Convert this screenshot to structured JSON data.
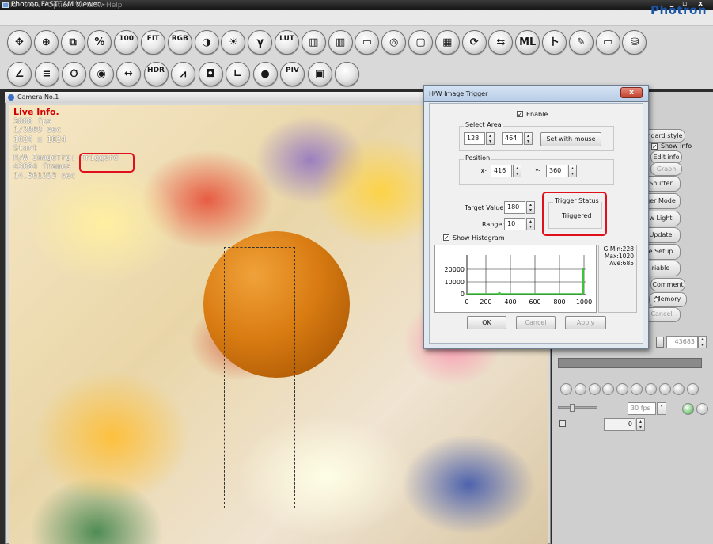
{
  "window": {
    "title": "Photron FASTCAM Viewer -",
    "min": "_",
    "max": "▫",
    "close": "x"
  },
  "menu": {
    "items": [
      "File",
      "View",
      "Option",
      "Window",
      "Help"
    ]
  },
  "brand": "Photron",
  "toolbar1": [
    {
      "name": "move",
      "glyph": "✥"
    },
    {
      "name": "zoom",
      "glyph": "⊕"
    },
    {
      "name": "clip",
      "glyph": "⧉"
    },
    {
      "name": "percent",
      "glyph": "%"
    },
    {
      "name": "zoom-100",
      "glyph": "100"
    },
    {
      "name": "fit",
      "glyph": "FIT"
    },
    {
      "name": "rgb",
      "glyph": "RGB"
    },
    {
      "name": "contrast",
      "glyph": "◑"
    },
    {
      "name": "brightness",
      "glyph": "☀"
    },
    {
      "name": "gamma",
      "glyph": "γ"
    },
    {
      "name": "lut-reset",
      "glyph": "LUT"
    },
    {
      "name": "color-bars",
      "glyph": "▥"
    },
    {
      "name": "reset-bars",
      "glyph": "▥"
    },
    {
      "name": "shading",
      "glyph": "▭"
    },
    {
      "name": "origin",
      "glyph": "◎"
    },
    {
      "name": "frame",
      "glyph": "▢"
    },
    {
      "name": "multi-window",
      "glyph": "▦"
    },
    {
      "name": "refresh",
      "glyph": "⟳"
    },
    {
      "name": "sync",
      "glyph": "⇆"
    },
    {
      "name": "multi-lock",
      "glyph": "ML"
    },
    {
      "name": "trigger",
      "glyph": "ト"
    },
    {
      "name": "pen",
      "glyph": "✎"
    },
    {
      "name": "display",
      "glyph": "▭"
    },
    {
      "name": "drive",
      "glyph": "⛁"
    }
  ],
  "toolbar2": [
    {
      "name": "angle",
      "glyph": "∠"
    },
    {
      "name": "level",
      "glyph": "≡"
    },
    {
      "name": "timer",
      "glyph": "⏱"
    },
    {
      "name": "record",
      "glyph": "◉"
    },
    {
      "name": "distance",
      "glyph": "↔"
    },
    {
      "name": "hdr",
      "glyph": "HDR"
    },
    {
      "name": "waveform",
      "glyph": "⩘"
    },
    {
      "name": "camera",
      "glyph": "◘"
    },
    {
      "name": "graph",
      "glyph": "∟"
    },
    {
      "name": "dot",
      "glyph": "●"
    },
    {
      "name": "piv",
      "glyph": "PIV"
    },
    {
      "name": "panel",
      "glyph": "▣"
    },
    {
      "name": "blank",
      "glyph": ""
    }
  ],
  "camera": {
    "title": "Camera No.1"
  },
  "live_info": {
    "heading": "Live Info.",
    "lines": [
      "3000 fps",
      "1/3009 sec",
      "1024 x 1024",
      "Start",
      "H/W ImageTrg: Triggerd",
      "43684 frames",
      "14.561333 sec"
    ]
  },
  "right_panel": {
    "standard_style": "ndard style",
    "show_info": "Show info",
    "edit_info": "Edit info",
    "graph": "Graph",
    "buttons": [
      "Shutter",
      "ger Mode",
      "w Light",
      "Update",
      "e Setup",
      "riable"
    ],
    "comment": "Comment",
    "memory": "Memory",
    "cancel": "Cancel",
    "frame_value": "43683",
    "fps_select": "30 fps"
  },
  "dialog": {
    "title": "H/W Image Trigger",
    "close": "x",
    "enable_label": "Enable",
    "enable_checked": true,
    "select_area_label": "Select Area",
    "area_x": "128",
    "area_y": "464",
    "set_with_mouse": "Set with mouse",
    "position_label": "Position",
    "pos_x_label": "X:",
    "pos_x": "416",
    "pos_y_label": "Y:",
    "pos_y": "360",
    "target_value_label": "Target Value:",
    "target_value": "180",
    "range_label": "Range:",
    "range": "10",
    "trigger_status_label": "Trigger Status",
    "trigger_status": "Triggered",
    "show_histogram": "Show Histogram",
    "histogram": {
      "y_ticks": [
        "20000",
        "10000",
        "0"
      ],
      "x_ticks": [
        "0",
        "200",
        "400",
        "600",
        "800",
        "1000"
      ]
    },
    "stats": [
      "G:Min:228",
      "Max:1020",
      "Ave:685"
    ],
    "ok": "OK",
    "cancel": "Cancel",
    "apply": "Apply"
  }
}
